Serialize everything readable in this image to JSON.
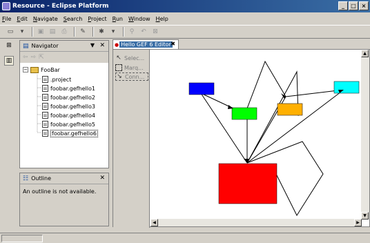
{
  "window": {
    "title": "Resource - Eclipse Platform",
    "controls": [
      "_",
      "□",
      "×"
    ]
  },
  "menu": [
    "File",
    "Edit",
    "Navigate",
    "Search",
    "Project",
    "Run",
    "Window",
    "Help"
  ],
  "navigator": {
    "title": "Navigator",
    "tree": {
      "root": "FooBar",
      "items": [
        ".project",
        "foobar.gefhello1",
        "foobar.gefhello2",
        "foobar.gefhello3",
        "foobar.gefhello4",
        "foobar.gefhello5",
        "foobar.gefhello6"
      ],
      "selected_index": 6
    }
  },
  "outline": {
    "title": "Outline",
    "message": "An outline is not available."
  },
  "editor": {
    "tab_title": "Hello GEF 6 Editor",
    "palette": [
      {
        "label": "Selec...",
        "icon": "arrow-cursor-icon",
        "active": false
      },
      {
        "label": "Marq...",
        "icon": "marquee-icon",
        "active": false
      },
      {
        "label": "Conn...",
        "icon": "connection-icon",
        "active": true
      }
    ]
  },
  "diagram": {
    "nodes": [
      {
        "id": "blue",
        "color": "#0000ff"
      },
      {
        "id": "green",
        "color": "#00ff00"
      },
      {
        "id": "orange",
        "color": "#ffb000"
      },
      {
        "id": "cyan",
        "color": "#00ffff"
      },
      {
        "id": "red",
        "color": "#ff0000"
      }
    ],
    "connection_color": "#000000"
  }
}
